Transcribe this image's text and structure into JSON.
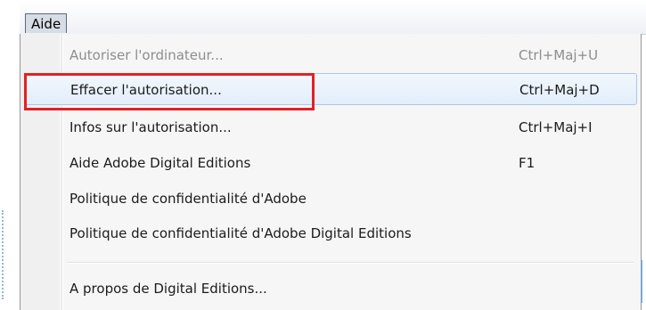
{
  "menubar": {
    "active_menu": "Aide"
  },
  "menu": {
    "items": [
      {
        "label": "Autoriser l'ordinateur...",
        "shortcut": "Ctrl+Maj+U",
        "state": "disabled"
      },
      {
        "label": "Effacer l'autorisation...",
        "shortcut": "Ctrl+Maj+D",
        "state": "hover"
      },
      {
        "label": "Infos sur l'autorisation...",
        "shortcut": "Ctrl+Maj+I",
        "state": "normal"
      },
      {
        "label": "Aide Adobe Digital Editions",
        "shortcut": "F1",
        "state": "normal"
      },
      {
        "label": "Politique de confidentialité d'Adobe",
        "shortcut": "",
        "state": "normal"
      },
      {
        "label": "Politique de confidentialité d'Adobe Digital Editions",
        "shortcut": "",
        "state": "normal"
      },
      {
        "label": "A propos de Digital Editions...",
        "shortcut": "",
        "state": "normal"
      }
    ]
  },
  "annotation": {
    "highlight_color": "#e41f26"
  },
  "colors": {
    "hover_background": "#e3eefb",
    "hover_border": "#a8c8ea",
    "disabled_text": "#8d8d8d"
  }
}
